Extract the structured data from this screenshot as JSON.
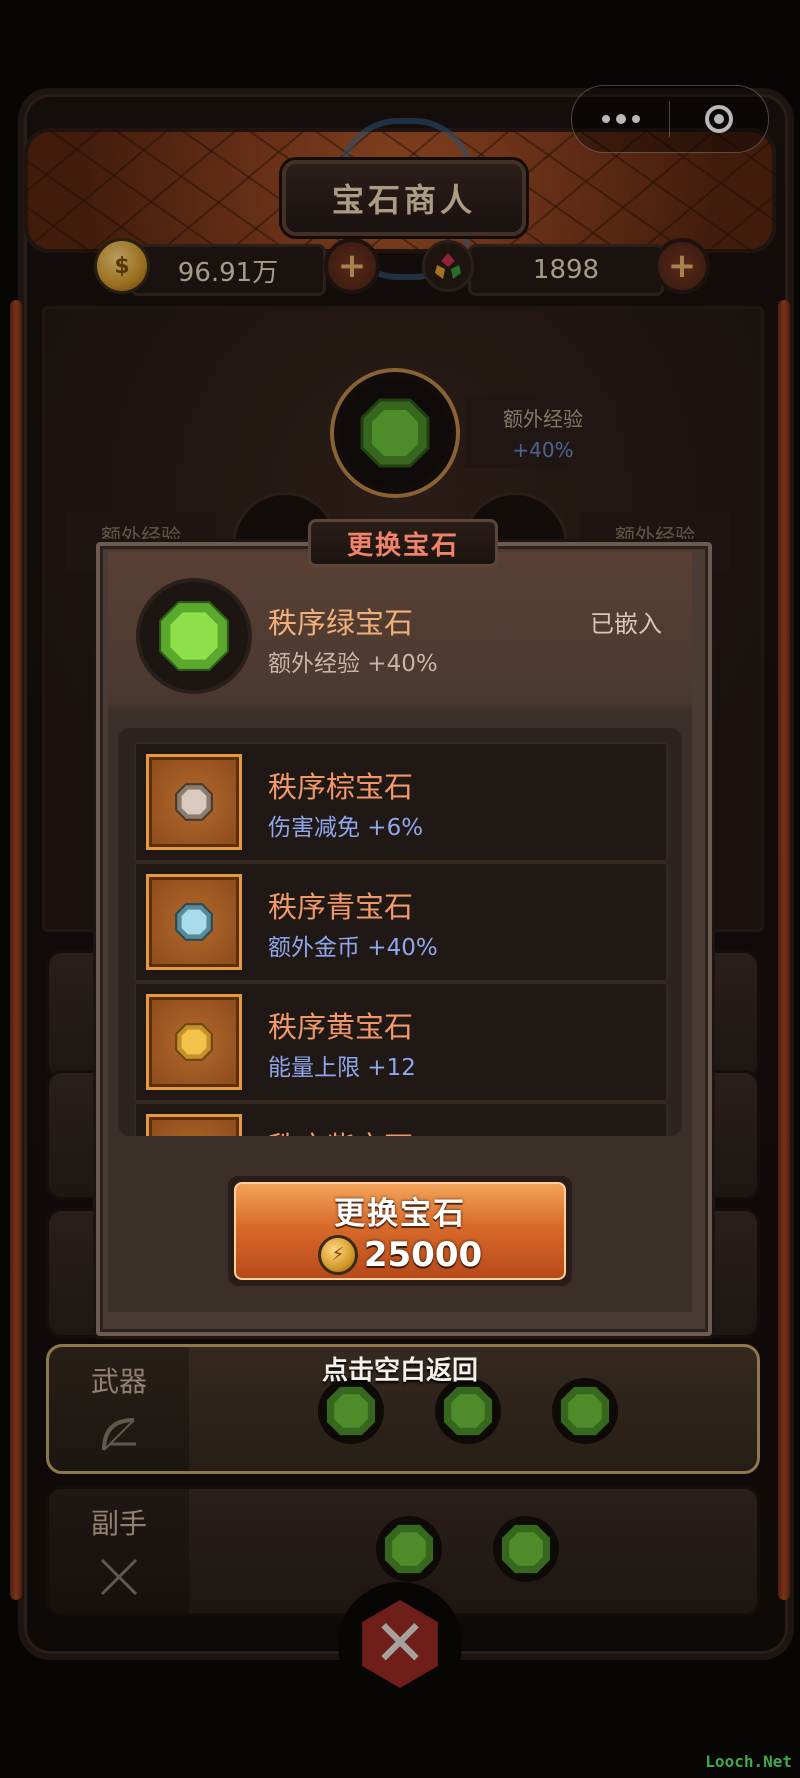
{
  "header": {
    "title": "宝石商人",
    "gold_amount": "96.91万",
    "gem_amount": "1898"
  },
  "background": {
    "center_gem_tag": {
      "label": "额外经验",
      "value": "+40%"
    },
    "left_tag_label": "额外经验",
    "right_tag_label": "额外经验"
  },
  "slots": [
    {
      "label": "武器",
      "icon": "bow-icon",
      "gems": 3
    },
    {
      "label": "副手",
      "icon": "crossed-arrows-icon",
      "gems": 2
    }
  ],
  "modal": {
    "title": "更换宝石",
    "current": {
      "name": "秩序绿宝石",
      "effect": "额外经验 +40%",
      "status": "已嵌入",
      "color": "#6cc23a"
    },
    "options": [
      {
        "name": "秩序棕宝石",
        "effect": "伤害减免 +6%",
        "color": "#d8cbbd"
      },
      {
        "name": "秩序青宝石",
        "effect": "额外金币 +40%",
        "color": "#a8dcea"
      },
      {
        "name": "秩序黄宝石",
        "effect": "能量上限 +12",
        "color": "#f3c24a"
      },
      {
        "name": "秩序紫宝石",
        "effect": "",
        "color": "#b07ad8"
      }
    ],
    "button": {
      "label": "更换宝石",
      "cost": "25000"
    }
  },
  "hint": "点击空白返回",
  "watermark": "Looch.Net",
  "colors": {
    "accent_orange": "#f0986a",
    "effect_blue": "#8fa6ec",
    "green_gem": "#6cc23a"
  }
}
